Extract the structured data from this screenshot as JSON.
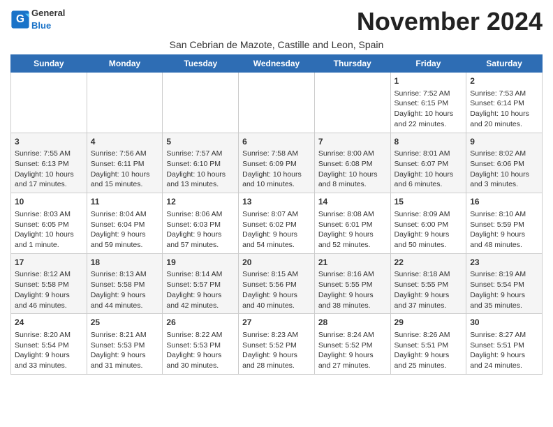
{
  "header": {
    "logo_general": "General",
    "logo_blue": "Blue",
    "month_year": "November 2024",
    "subtitle": "San Cebrian de Mazote, Castille and Leon, Spain"
  },
  "weekdays": [
    "Sunday",
    "Monday",
    "Tuesday",
    "Wednesday",
    "Thursday",
    "Friday",
    "Saturday"
  ],
  "weeks": [
    [
      {
        "day": "",
        "info": ""
      },
      {
        "day": "",
        "info": ""
      },
      {
        "day": "",
        "info": ""
      },
      {
        "day": "",
        "info": ""
      },
      {
        "day": "",
        "info": ""
      },
      {
        "day": "1",
        "info": "Sunrise: 7:52 AM\nSunset: 6:15 PM\nDaylight: 10 hours and 22 minutes."
      },
      {
        "day": "2",
        "info": "Sunrise: 7:53 AM\nSunset: 6:14 PM\nDaylight: 10 hours and 20 minutes."
      }
    ],
    [
      {
        "day": "3",
        "info": "Sunrise: 7:55 AM\nSunset: 6:13 PM\nDaylight: 10 hours and 17 minutes."
      },
      {
        "day": "4",
        "info": "Sunrise: 7:56 AM\nSunset: 6:11 PM\nDaylight: 10 hours and 15 minutes."
      },
      {
        "day": "5",
        "info": "Sunrise: 7:57 AM\nSunset: 6:10 PM\nDaylight: 10 hours and 13 minutes."
      },
      {
        "day": "6",
        "info": "Sunrise: 7:58 AM\nSunset: 6:09 PM\nDaylight: 10 hours and 10 minutes."
      },
      {
        "day": "7",
        "info": "Sunrise: 8:00 AM\nSunset: 6:08 PM\nDaylight: 10 hours and 8 minutes."
      },
      {
        "day": "8",
        "info": "Sunrise: 8:01 AM\nSunset: 6:07 PM\nDaylight: 10 hours and 6 minutes."
      },
      {
        "day": "9",
        "info": "Sunrise: 8:02 AM\nSunset: 6:06 PM\nDaylight: 10 hours and 3 minutes."
      }
    ],
    [
      {
        "day": "10",
        "info": "Sunrise: 8:03 AM\nSunset: 6:05 PM\nDaylight: 10 hours and 1 minute."
      },
      {
        "day": "11",
        "info": "Sunrise: 8:04 AM\nSunset: 6:04 PM\nDaylight: 9 hours and 59 minutes."
      },
      {
        "day": "12",
        "info": "Sunrise: 8:06 AM\nSunset: 6:03 PM\nDaylight: 9 hours and 57 minutes."
      },
      {
        "day": "13",
        "info": "Sunrise: 8:07 AM\nSunset: 6:02 PM\nDaylight: 9 hours and 54 minutes."
      },
      {
        "day": "14",
        "info": "Sunrise: 8:08 AM\nSunset: 6:01 PM\nDaylight: 9 hours and 52 minutes."
      },
      {
        "day": "15",
        "info": "Sunrise: 8:09 AM\nSunset: 6:00 PM\nDaylight: 9 hours and 50 minutes."
      },
      {
        "day": "16",
        "info": "Sunrise: 8:10 AM\nSunset: 5:59 PM\nDaylight: 9 hours and 48 minutes."
      }
    ],
    [
      {
        "day": "17",
        "info": "Sunrise: 8:12 AM\nSunset: 5:58 PM\nDaylight: 9 hours and 46 minutes."
      },
      {
        "day": "18",
        "info": "Sunrise: 8:13 AM\nSunset: 5:58 PM\nDaylight: 9 hours and 44 minutes."
      },
      {
        "day": "19",
        "info": "Sunrise: 8:14 AM\nSunset: 5:57 PM\nDaylight: 9 hours and 42 minutes."
      },
      {
        "day": "20",
        "info": "Sunrise: 8:15 AM\nSunset: 5:56 PM\nDaylight: 9 hours and 40 minutes."
      },
      {
        "day": "21",
        "info": "Sunrise: 8:16 AM\nSunset: 5:55 PM\nDaylight: 9 hours and 38 minutes."
      },
      {
        "day": "22",
        "info": "Sunrise: 8:18 AM\nSunset: 5:55 PM\nDaylight: 9 hours and 37 minutes."
      },
      {
        "day": "23",
        "info": "Sunrise: 8:19 AM\nSunset: 5:54 PM\nDaylight: 9 hours and 35 minutes."
      }
    ],
    [
      {
        "day": "24",
        "info": "Sunrise: 8:20 AM\nSunset: 5:54 PM\nDaylight: 9 hours and 33 minutes."
      },
      {
        "day": "25",
        "info": "Sunrise: 8:21 AM\nSunset: 5:53 PM\nDaylight: 9 hours and 31 minutes."
      },
      {
        "day": "26",
        "info": "Sunrise: 8:22 AM\nSunset: 5:53 PM\nDaylight: 9 hours and 30 minutes."
      },
      {
        "day": "27",
        "info": "Sunrise: 8:23 AM\nSunset: 5:52 PM\nDaylight: 9 hours and 28 minutes."
      },
      {
        "day": "28",
        "info": "Sunrise: 8:24 AM\nSunset: 5:52 PM\nDaylight: 9 hours and 27 minutes."
      },
      {
        "day": "29",
        "info": "Sunrise: 8:26 AM\nSunset: 5:51 PM\nDaylight: 9 hours and 25 minutes."
      },
      {
        "day": "30",
        "info": "Sunrise: 8:27 AM\nSunset: 5:51 PM\nDaylight: 9 hours and 24 minutes."
      }
    ]
  ]
}
